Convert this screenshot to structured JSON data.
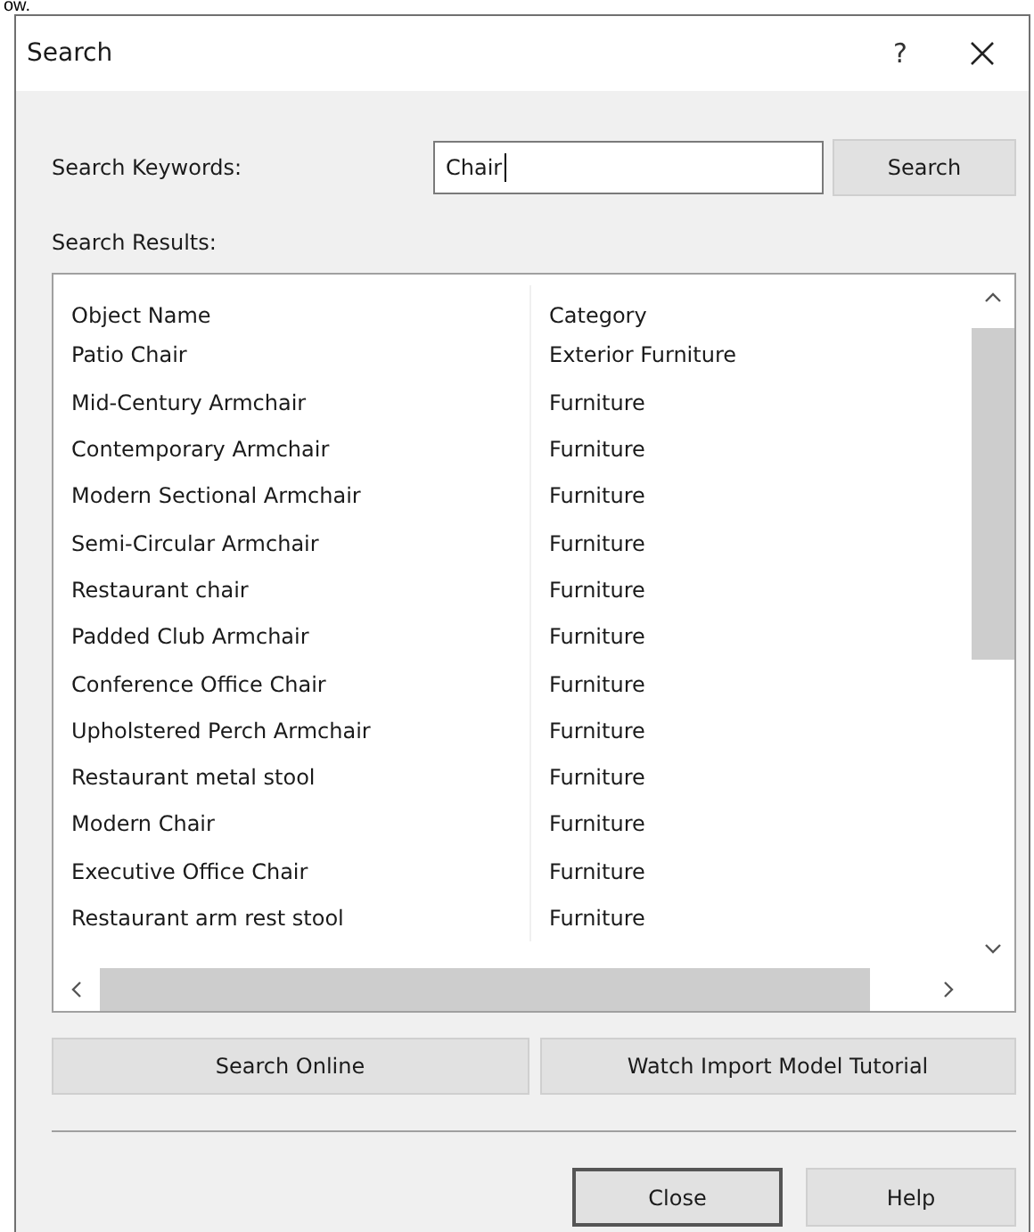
{
  "caption": "ow.",
  "window": {
    "title": "Search",
    "help_glyph": "?"
  },
  "keywords": {
    "label": "Search Keywords:",
    "value": "Chair",
    "button": "Search"
  },
  "results": {
    "label": "Search Results:",
    "columns": [
      "Object Name",
      "Category"
    ],
    "rows": [
      {
        "name": "Patio Chair",
        "category": "Exterior Furniture"
      },
      {
        "name": "Mid-Century Armchair",
        "category": "Furniture"
      },
      {
        "name": "Contemporary Armchair",
        "category": "Furniture"
      },
      {
        "name": "Modern Sectional Armchair",
        "category": "Furniture"
      },
      {
        "name": "Semi-Circular Armchair",
        "category": "Furniture"
      },
      {
        "name": "Restaurant chair",
        "category": "Furniture"
      },
      {
        "name": "Padded Club Armchair",
        "category": "Furniture"
      },
      {
        "name": "Conference Office Chair",
        "category": "Furniture"
      },
      {
        "name": "Upholstered Perch Armchair",
        "category": "Furniture"
      },
      {
        "name": "Restaurant metal stool",
        "category": "Furniture"
      },
      {
        "name": "Modern Chair",
        "category": "Furniture"
      },
      {
        "name": "Executive Office Chair",
        "category": "Furniture"
      },
      {
        "name": "Restaurant arm rest stool",
        "category": "Furniture"
      }
    ]
  },
  "actions": [
    "Search Online",
    "Watch Import Model Tutorial"
  ],
  "footer_buttons": [
    {
      "label": "Close",
      "default": true
    },
    {
      "label": "Help",
      "default": false
    }
  ]
}
